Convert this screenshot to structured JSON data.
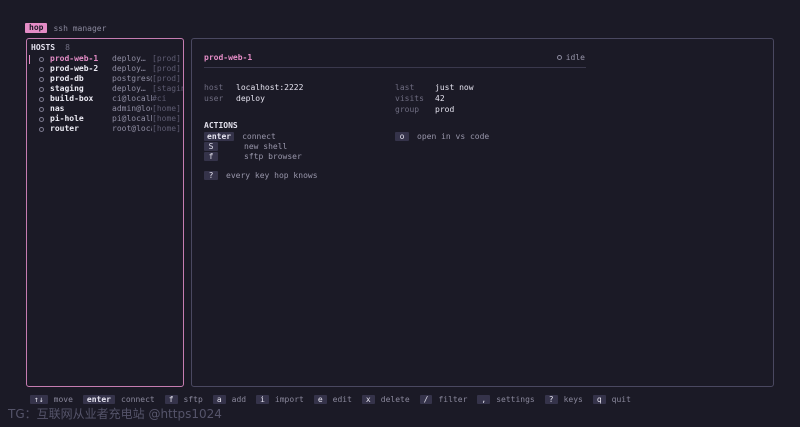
{
  "app": {
    "badge": "hop",
    "subtitle": "ssh manager"
  },
  "sidebar": {
    "title": "HOSTS",
    "count": "8",
    "hosts": [
      {
        "name": "prod-web-1",
        "user": "deploy…",
        "tag": "[prod]",
        "selected": true
      },
      {
        "name": "prod-web-2",
        "user": "deploy…",
        "tag": "[prod]"
      },
      {
        "name": "prod-db",
        "user": "postgres@…",
        "tag": "[prod]"
      },
      {
        "name": "staging",
        "user": "deploy…",
        "tag": "[stagin]"
      },
      {
        "name": "build-box",
        "user": "ci@localho…",
        "tag": "#ci"
      },
      {
        "name": "nas",
        "user": "admin@localho…",
        "tag": "[home]"
      },
      {
        "name": "pi-hole",
        "user": "pi@localh…",
        "tag": "[home]"
      },
      {
        "name": "router",
        "user": "root@local…",
        "tag": "[home]"
      }
    ]
  },
  "detail": {
    "title": "prod-web-1",
    "status": "idle",
    "host_label": "host",
    "host_value": "localhost:2222",
    "user_label": "user",
    "user_value": "deploy",
    "last_label": "last",
    "last_value": "just now",
    "visits_label": "visits",
    "visits_value": "42",
    "group_label": "group",
    "group_value": "prod",
    "actions_label": "ACTIONS",
    "actions": {
      "connect": {
        "key": "enter",
        "label": "connect"
      },
      "shell": {
        "key": "S",
        "label": "new shell"
      },
      "sftp": {
        "key": "f",
        "label": "sftp browser"
      },
      "vscode": {
        "key": "o",
        "label": "open in vs code"
      },
      "help": {
        "key": "?",
        "label": "every key hop knows"
      }
    }
  },
  "footer": [
    {
      "key": "↑↓",
      "label": "move"
    },
    {
      "key": "enter",
      "label": "connect"
    },
    {
      "key": "f",
      "label": "sftp"
    },
    {
      "key": "a",
      "label": "add"
    },
    {
      "key": "i",
      "label": "import"
    },
    {
      "key": "e",
      "label": "edit"
    },
    {
      "key": "x",
      "label": "delete"
    },
    {
      "key": "/",
      "label": "filter"
    },
    {
      "key": ",",
      "label": "settings"
    },
    {
      "key": "?",
      "label": "keys"
    },
    {
      "key": "q",
      "label": "quit"
    }
  ],
  "watermark": "TG：互联网从业者充电站 @https1024"
}
